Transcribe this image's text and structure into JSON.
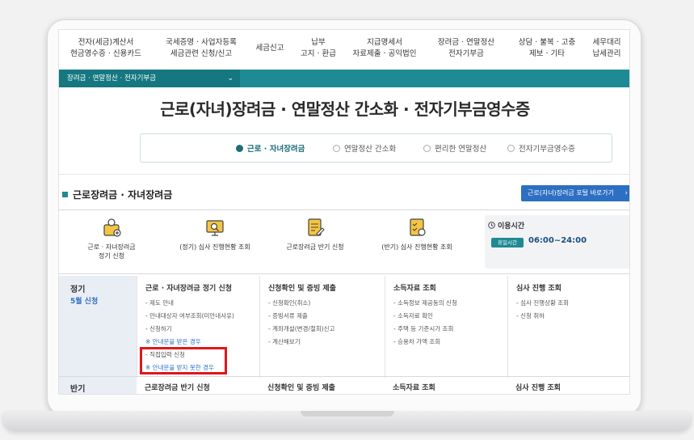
{
  "nav": {
    "items": [
      {
        "line1": "전자(세금)계산서",
        "line2": "현금영수증 · 신용카드"
      },
      {
        "line1": "국세증명 · 사업자등록",
        "line2": "세금관련 신청/신고"
      },
      {
        "line1": "세금신고",
        "line2": ""
      },
      {
        "line1": "납부",
        "line2": "고지 · 환급"
      },
      {
        "line1": "지급명세서",
        "line2": "자료제출 · 공익법인"
      },
      {
        "line1": "장려금 · 연말정산",
        "line2": "전자기부금"
      },
      {
        "line1": "상담 · 불복 · 고충",
        "line2": "제보 · 기타"
      },
      {
        "line1": "세무대리",
        "line2": "납세관리"
      }
    ]
  },
  "breadcrumb": {
    "label": "장려금 · 연말정산 · 전자기부금",
    "chevron": "⌄"
  },
  "page_title": "근로(자녀)장려금 · 연말정산 간소화 · 전자기부금영수증",
  "steps": [
    {
      "label": "근로 · 자녀장려금",
      "active": true
    },
    {
      "label": "연말정산 간소화",
      "active": false
    },
    {
      "label": "편리한 연말정산",
      "active": false
    },
    {
      "label": "전자기부금영수증",
      "active": false
    }
  ],
  "section": {
    "title": "근로장려금 · 자녀장려금",
    "shortcut_label": "근로(자녀)장려금 포털 바로가기",
    "shortcut_arrow": "›"
  },
  "services": [
    {
      "line1": "근로 · 자녀장려금",
      "line2": "정기 신청",
      "icon": "person-document-icon"
    },
    {
      "line1": "(정기) 심사 진행현황 조회",
      "line2": "",
      "icon": "monitor-search-icon"
    },
    {
      "line1": "근로장려금 반기 신청",
      "line2": "",
      "icon": "form-pen-icon"
    },
    {
      "line1": "(반기) 심사 진행현황 조회",
      "line2": "",
      "icon": "checklist-icon"
    }
  ],
  "hours": {
    "label": "이용시간",
    "badge": "휴일시간",
    "time": "06:00~24:00"
  },
  "grid": {
    "period": "정기",
    "period_sub": "5월 신청",
    "columns": [
      {
        "title": "근로 · 자녀장려금 정기 신청",
        "items": [
          {
            "text": "제도 안내",
            "note": false
          },
          {
            "text": "안내대상자 여부조회(미안내사유)",
            "note": false
          },
          {
            "text": "신청하기",
            "note": false
          },
          {
            "text": "안내문을 받은 경우",
            "note": true
          },
          {
            "text": "직접입력 신청",
            "note": false
          },
          {
            "text": "안내문을 받지 못한 경우",
            "note": true
          }
        ]
      },
      {
        "title": "신청확인 및 증빙 제출",
        "items": [
          {
            "text": "신청확인(취소)",
            "note": false
          },
          {
            "text": "증빙서류 제출",
            "note": false
          },
          {
            "text": "계좌개설(변경/철회)신고",
            "note": false
          },
          {
            "text": "계산해보기",
            "note": false
          }
        ]
      },
      {
        "title": "소득자료 조회",
        "items": [
          {
            "text": "소득정보 제공동의 신청",
            "note": false
          },
          {
            "text": "소득자료 확인",
            "note": false
          },
          {
            "text": "주택 등 기준시가 조회",
            "note": false
          },
          {
            "text": "승용차 가액 조회",
            "note": false
          }
        ]
      },
      {
        "title": "심사 진행 조회",
        "items": [
          {
            "text": "심사 진행상황 조회",
            "note": false
          },
          {
            "text": "신청 취하",
            "note": false
          }
        ]
      }
    ]
  },
  "row2": {
    "period": "반기",
    "columns": [
      "근로장려금 반기 신청",
      "신청확인 및 증빙 제출",
      "소득자료 조회",
      "심사 진행 조회"
    ]
  },
  "colors": {
    "teal": "#1e8a93",
    "blue": "#2d6fc2",
    "highlight": "#e0161b"
  }
}
